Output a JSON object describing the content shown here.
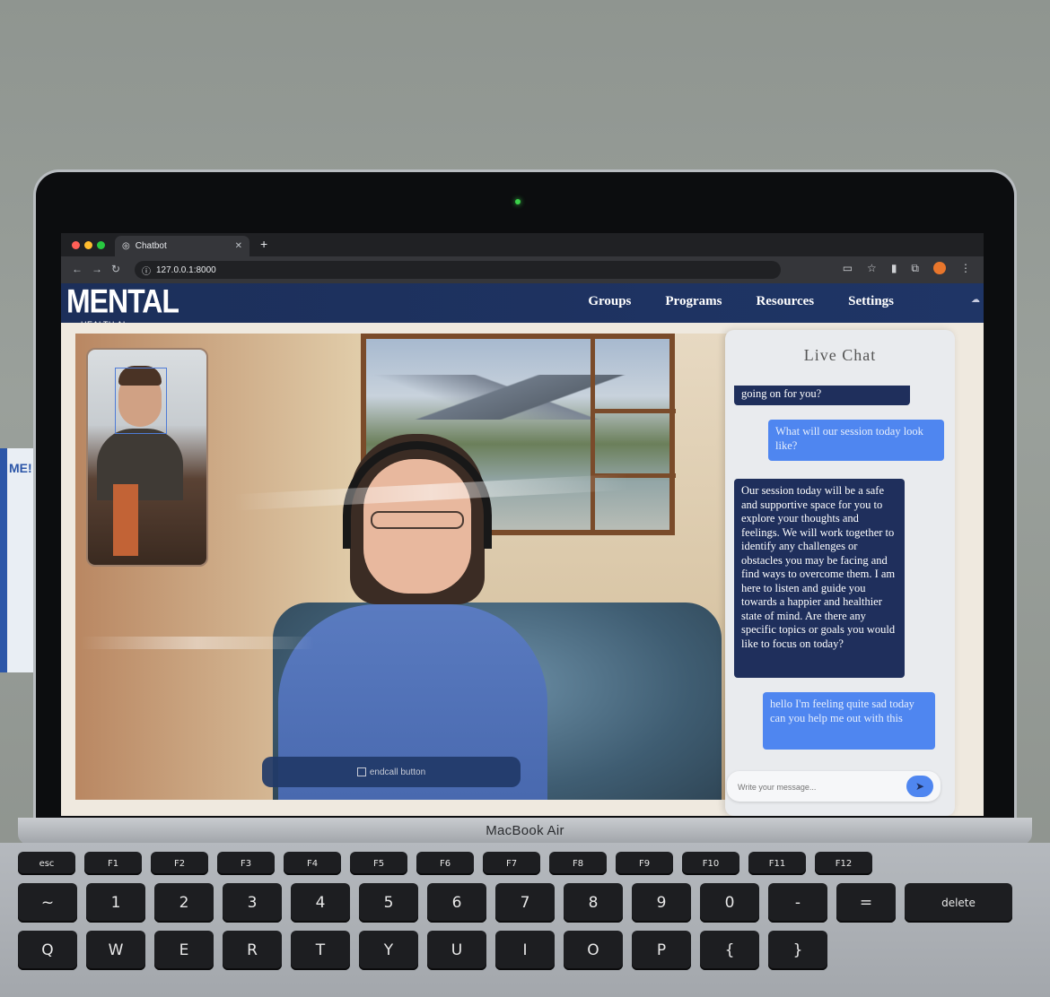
{
  "browser": {
    "tab_title": "Chatbot",
    "url": "127.0.0.1:8000",
    "traffic_colors": [
      "#ff5f57",
      "#febc2e",
      "#28c840"
    ]
  },
  "site": {
    "logo_main": "MENTAL",
    "logo_sub": "HEALTH AI",
    "nav": [
      "Groups",
      "Programs",
      "Resources",
      "Settings"
    ]
  },
  "video": {
    "call_button_alt": "endcall button"
  },
  "chat": {
    "title": "Live Chat",
    "messages": [
      {
        "role": "bot",
        "text": "going on for you?"
      },
      {
        "role": "user",
        "text": "What will our session today look like?"
      },
      {
        "role": "bot",
        "text": "Our session today will be a safe and supportive space for you to explore your thoughts and feelings. We will work together to identify any challenges or obstacles you may be facing and find ways to overcome them. I am here to listen and guide you towards a happier and healthier state of mind. Are there any specific topics or goals you would like to focus on today?"
      },
      {
        "role": "user",
        "text": "hello I'm feeling quite sad today can you help me out with this"
      }
    ],
    "input_placeholder": "Write your message...",
    "send_icon": "send-arrow-icon"
  },
  "device": {
    "label": "MacBook Air"
  },
  "keyboard": {
    "fn_row": [
      "esc",
      "F1",
      "F2",
      "F3",
      "F4",
      "F5",
      "F6",
      "F7",
      "F8",
      "F9",
      "F10",
      "F11",
      "F12"
    ],
    "num_row": [
      "~",
      "1",
      "2",
      "3",
      "4",
      "5",
      "6",
      "7",
      "8",
      "9",
      "0",
      "-",
      "=",
      "delete"
    ],
    "letter_row": [
      "Q",
      "W",
      "E",
      "R",
      "T",
      "Y",
      "U",
      "I",
      "O",
      "P",
      "{",
      "}"
    ]
  },
  "poster": {
    "text": "ME!"
  }
}
